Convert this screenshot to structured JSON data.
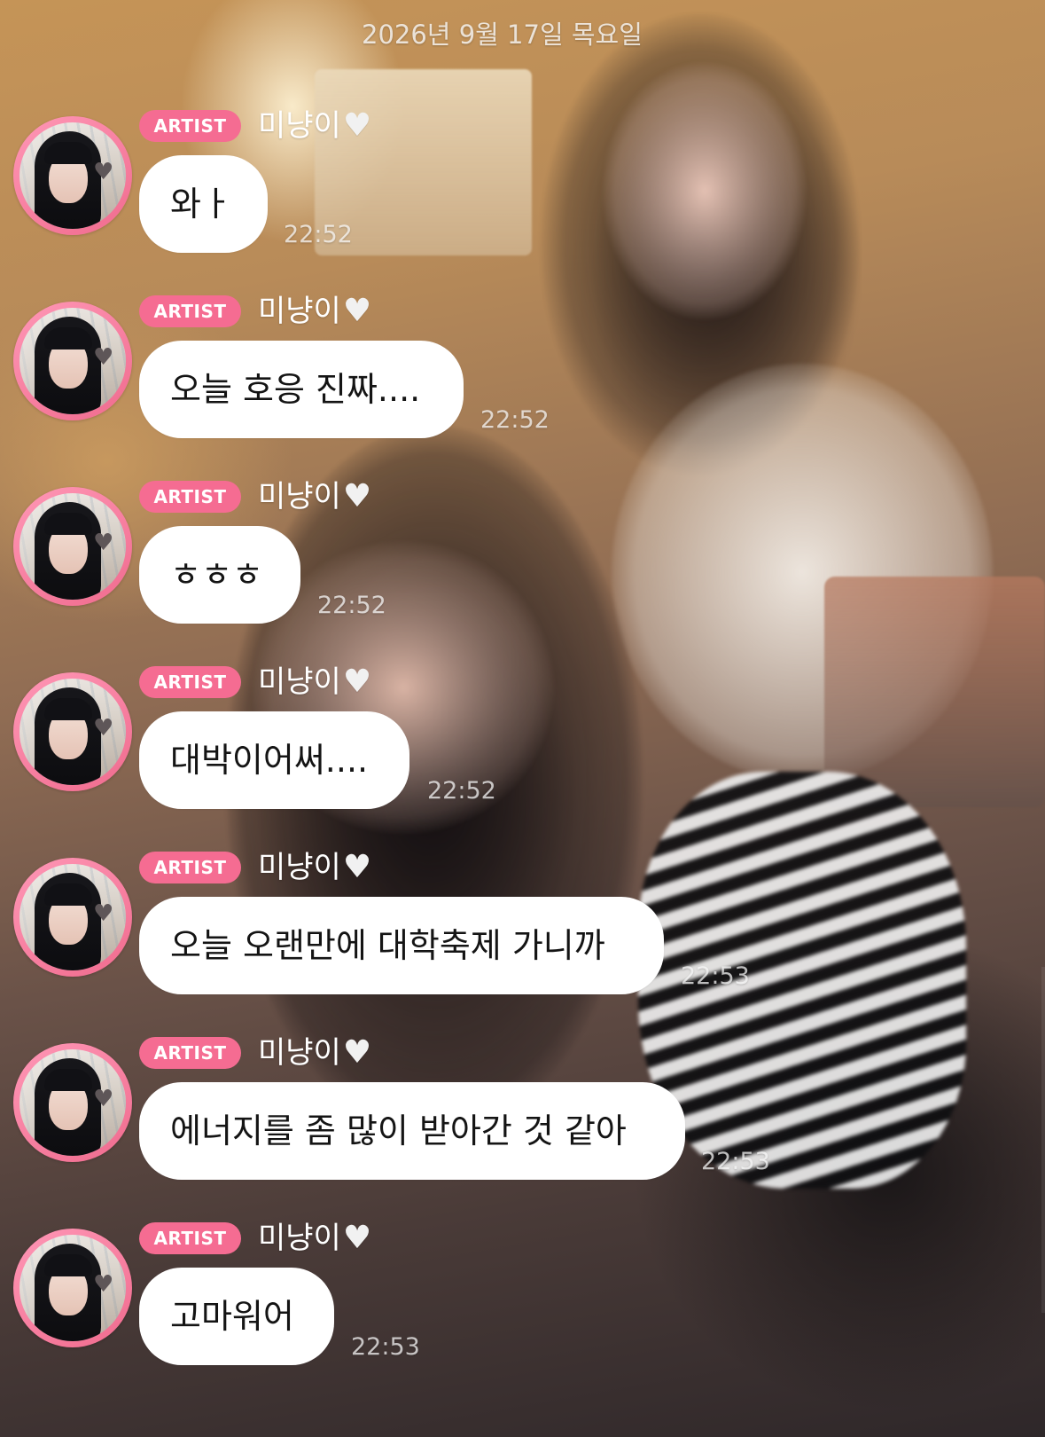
{
  "chat": {
    "date": "2026년 9월 17일 목요일",
    "badge": "ARTIST",
    "sender": "미냥이",
    "heart_icon": "white-heart-icon",
    "messages": [
      {
        "text": "와ㅏ",
        "time": "22:52"
      },
      {
        "text": "오늘 호응 진짜....",
        "time": "22:52"
      },
      {
        "text": "ㅎㅎㅎ",
        "time": "22:52"
      },
      {
        "text": "대박이어써....",
        "time": "22:52"
      },
      {
        "text": "오늘 오랜만에 대학축제 가니까",
        "time": "22:53"
      },
      {
        "text": "에너지를 좀 많이 받아간 것 같아",
        "time": "22:53"
      },
      {
        "text": "고마워어",
        "time": "22:53"
      }
    ]
  },
  "colors": {
    "badge_pink": "#f56c92",
    "avatar_ring": "#f06b8e",
    "bubble": "#ffffff"
  }
}
